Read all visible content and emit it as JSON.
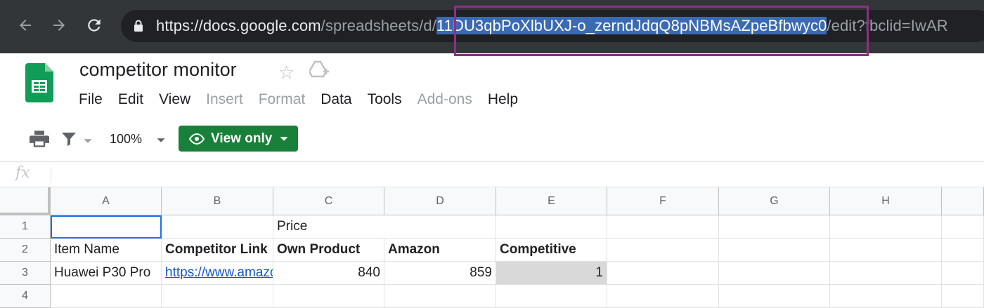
{
  "browser": {
    "url_host": "https://docs.google.com",
    "url_path": "/spreadsheets/d/",
    "url_selected": "11DU3qbPoXlbUXJ-o_zerndJdqQ8pNBMsAZpeBfbwyc0",
    "url_rest": "/edit?fbclid=IwAR"
  },
  "document": {
    "title": "competitor monitor"
  },
  "menu": [
    "File",
    "Edit",
    "View",
    "Insert",
    "Format",
    "Data",
    "Tools",
    "Add-ons",
    "Help"
  ],
  "menu_disabled": [
    "Insert",
    "Format",
    "Add-ons"
  ],
  "toolbar": {
    "zoom": "100%",
    "view_only": "View only"
  },
  "formula_bar": {
    "fx": "fx"
  },
  "sheet": {
    "columns": [
      "A",
      "B",
      "C",
      "D",
      "E",
      "F",
      "G",
      "H"
    ],
    "rows": [
      "1",
      "2",
      "3",
      "4"
    ],
    "cells": {
      "C1": "Price",
      "A2": "Item Name",
      "B2": "Competitor Link",
      "C2": "Own Product",
      "D2": "Amazon",
      "E2": "Competitive",
      "A3": "Huawei P30 Pro",
      "B3": "https://www.amazon",
      "C3": "840",
      "D3": "859",
      "E3": "1"
    }
  },
  "colors": {
    "view_only_bg": "#188038",
    "link": "#1155cc",
    "highlight_box": "#8e2f88"
  }
}
